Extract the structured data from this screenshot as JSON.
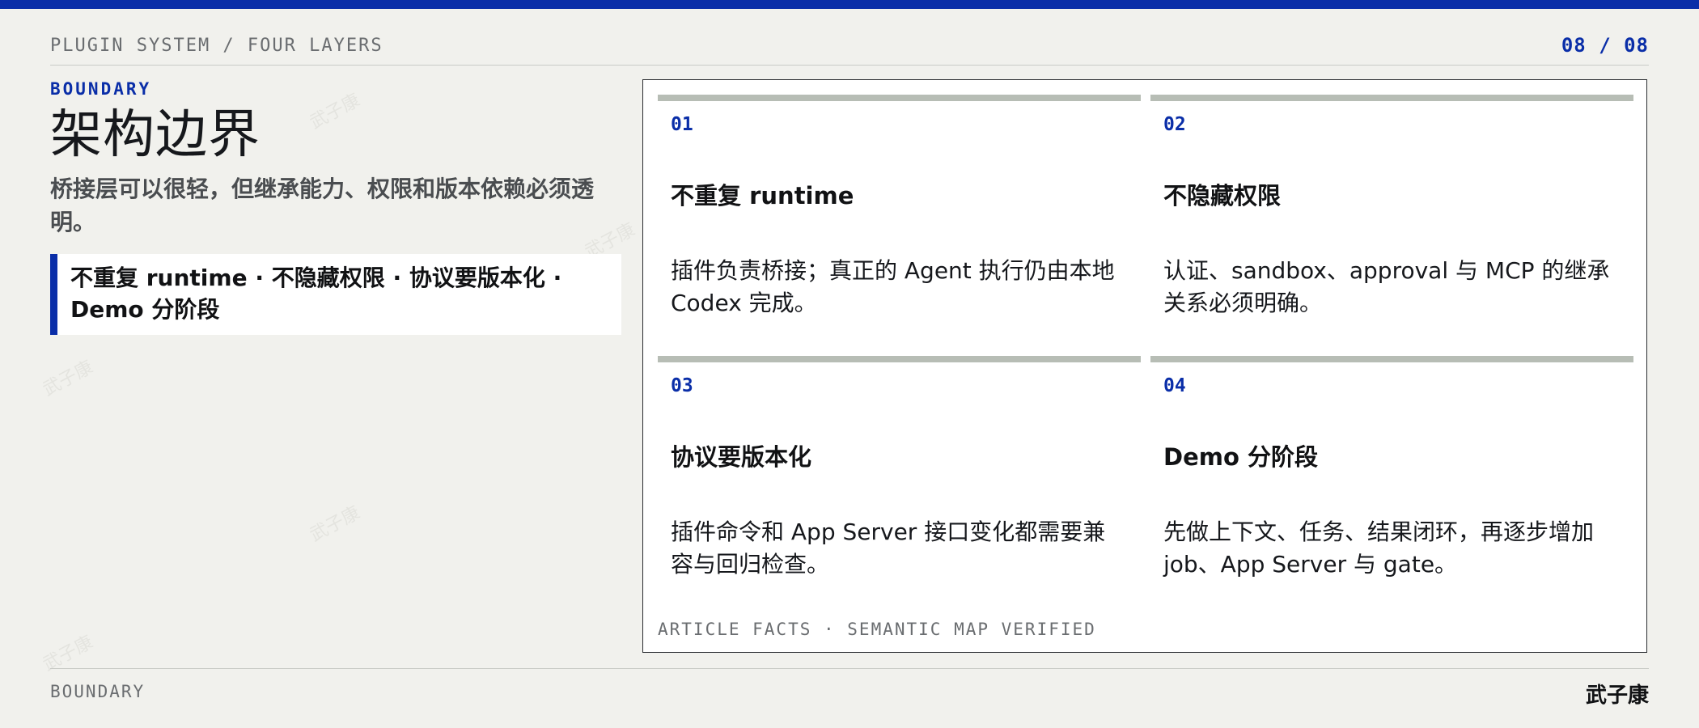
{
  "header": {
    "breadcrumb": "PLUGIN SYSTEM / FOUR LAYERS",
    "page_indicator": "08 / 08"
  },
  "left": {
    "kicker": "BOUNDARY",
    "title": "架构边界",
    "subtitle": "桥接层可以很轻，但继承能力、权限和版本依赖必须透明。",
    "callout": "不重复 runtime · 不隐藏权限 · 协议要版本化 · Demo 分阶段"
  },
  "cards": [
    {
      "num": "01",
      "title": "不重复 runtime",
      "body": "插件负责桥接；真正的 Agent 执行仍由本地 Codex 完成。"
    },
    {
      "num": "02",
      "title": "不隐藏权限",
      "body": "认证、sandbox、approval 与 MCP 的继承关系必须明确。"
    },
    {
      "num": "03",
      "title": "协议要版本化",
      "body": "插件命令和 App Server 接口变化都需要兼容与回归检查。"
    },
    {
      "num": "04",
      "title": "Demo 分阶段",
      "body": "先做上下文、任务、结果闭环，再逐步增加 job、App Server 与 gate。"
    }
  ],
  "panel_footer": "ARTICLE FACTS · SEMANTIC MAP VERIFIED",
  "footer": {
    "label": "BOUNDARY",
    "author": "武子康"
  },
  "watermark": {
    "text": "武子康"
  },
  "colors": {
    "accent": "#0a2ea8",
    "background": "#f1f1ed",
    "card_rule": "#b7bdb5"
  }
}
